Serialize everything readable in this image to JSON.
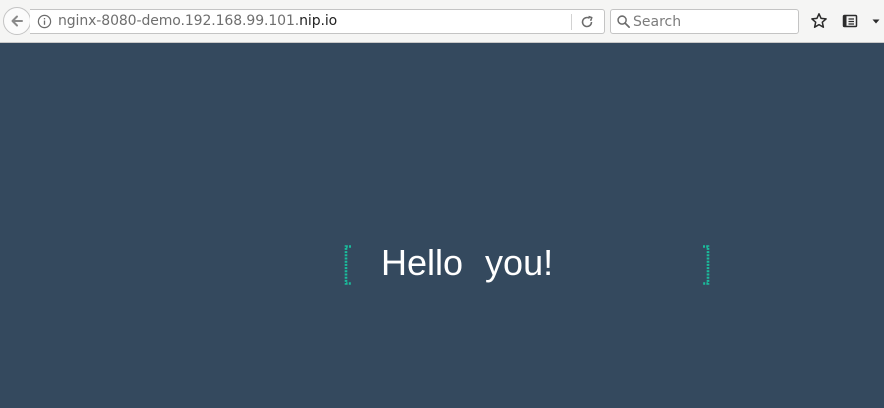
{
  "browser": {
    "url_path": "nginx-8080-demo.192.168.99.101.",
    "url_domain": "nip.io",
    "search_placeholder": "Search"
  },
  "icons": {
    "back": "back-arrow-icon",
    "info": "info-icon",
    "reload": "reload-icon",
    "search": "search-icon",
    "bookmark": "star-icon",
    "reader": "reader-view-icon",
    "menu": "chevron-down-icon"
  },
  "page": {
    "greeting_word1": "Hello",
    "greeting_word2": "you!",
    "bracket_open": "[",
    "bracket_close": "]"
  },
  "colors": {
    "background": "#34495e",
    "text": "#ffffff",
    "accent": "#1abc9c"
  }
}
